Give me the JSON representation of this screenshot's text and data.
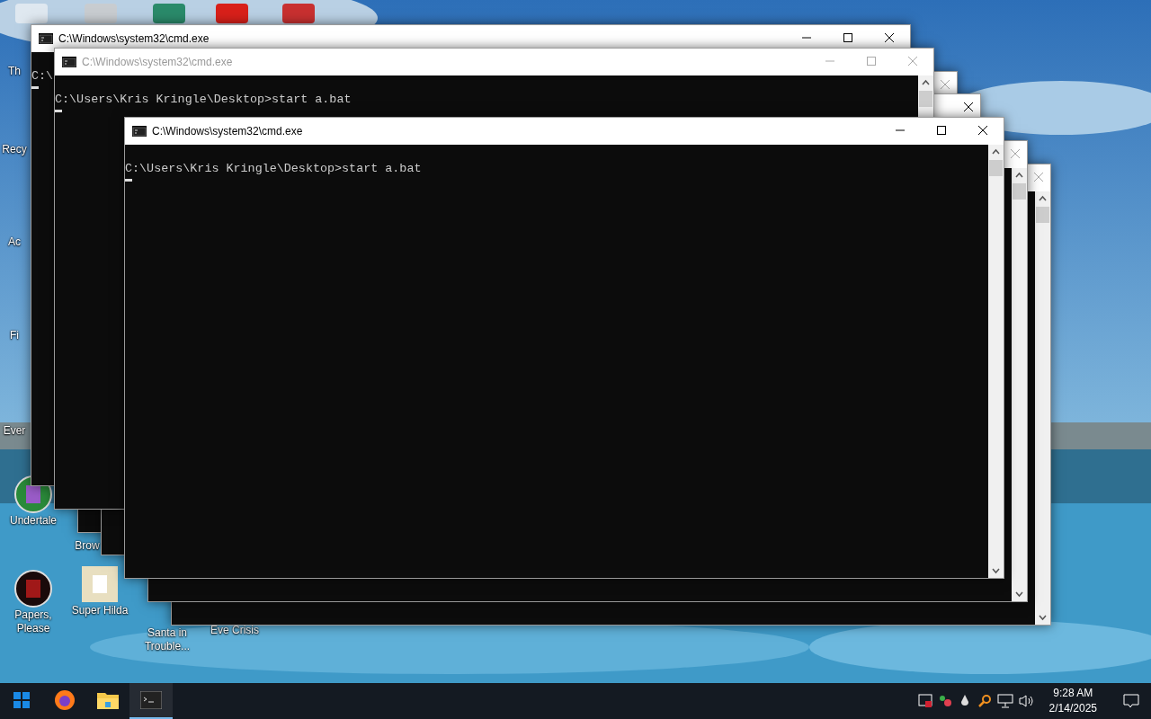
{
  "desktop_icons": [
    {
      "label": "Th"
    },
    {
      "label": "Recy"
    },
    {
      "label": "Ac"
    },
    {
      "label": "Fi"
    },
    {
      "label": "Ever"
    },
    {
      "label": "Undertale"
    },
    {
      "label": "Brow"
    },
    {
      "label": "Papers, Please"
    },
    {
      "label": "Super Hilda"
    },
    {
      "label": "Santa in Trouble..."
    },
    {
      "label": "Eve Crisis"
    }
  ],
  "windows": [
    {
      "title": "C:\\Windows\\system32\\cmd.exe",
      "active": true,
      "lines": [
        "C:\\"
      ],
      "cursor": true
    },
    {
      "title": "C:\\Windows\\system32\\cmd.exe",
      "active": false,
      "lines": [
        "C:\\Users\\Kris Kringle\\Desktop>start a.bat"
      ],
      "cursor": true
    },
    {
      "active": false
    },
    {
      "active": true
    },
    {
      "title": "C:\\Windows\\system32\\cmd.exe",
      "active": true,
      "lines": [
        "C:\\Users\\Kris Kringle\\Desktop>start a.bat"
      ],
      "cursor": true
    },
    {
      "active": false
    },
    {
      "active": false
    }
  ],
  "taskbar": {
    "apps": [
      {
        "kind": "start",
        "selected": false
      },
      {
        "kind": "browser",
        "selected": false
      },
      {
        "kind": "folder",
        "selected": false
      },
      {
        "kind": "terminal",
        "selected": true
      }
    ],
    "time": "9:28 AM",
    "date": "2/14/2025"
  }
}
